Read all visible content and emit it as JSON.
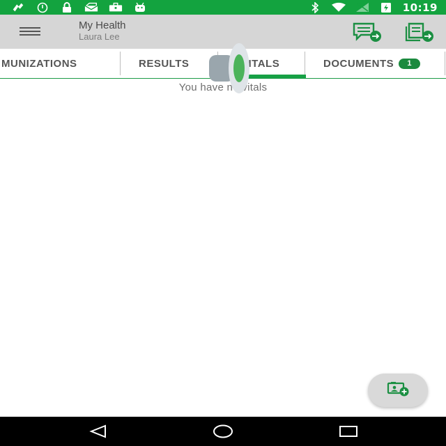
{
  "status_bar": {
    "time": "10:19",
    "left_icons": [
      "fax-icon",
      "alarm-icon",
      "lock-icon",
      "mail-icon",
      "briefcase-icon",
      "android-icon"
    ],
    "right_icons": [
      "bluetooth-icon",
      "wifi-icon",
      "signal-icon",
      "battery-charging-icon"
    ]
  },
  "app_bar": {
    "title": "My Health",
    "subtitle": "Laura Lee",
    "menu_icon": "hamburger-menu-icon",
    "actions": [
      "message-forward-icon",
      "document-forward-icon"
    ]
  },
  "tabs": {
    "items": [
      {
        "label": "MUNIZATIONS"
      },
      {
        "label": "RESULTS"
      },
      {
        "label": "VITALS",
        "selected": true
      },
      {
        "label": "DOCUMENTS",
        "badge": "1"
      }
    ]
  },
  "main": {
    "empty_message": "You have no vitals"
  },
  "fab": {
    "icon": "add-document-icon"
  },
  "nav_bar": {
    "buttons": [
      "back-icon",
      "home-icon",
      "recents-icon"
    ]
  },
  "colors": {
    "status_bar": "#13a33f",
    "app_bar": "#d6d6d6",
    "accent": "#17a145",
    "badge": "#1b8a3e"
  }
}
